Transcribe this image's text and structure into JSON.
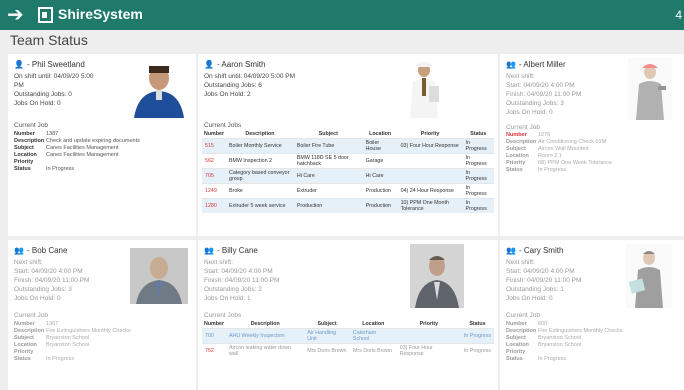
{
  "app": {
    "brand": "ShireSystem",
    "back_icon": "back-arrow-icon",
    "corner_glyph": "4"
  },
  "page": {
    "title": "Team Status"
  },
  "labels": {
    "current_job": "Current Job",
    "current_jobs": "Current Jobs",
    "number": "Number",
    "description": "Description",
    "subject": "Subject",
    "location": "Location",
    "priority": "Priority",
    "status": "Status"
  },
  "cards": [
    {
      "name": "- Phil Sweetland",
      "line1": "On shift until: 04/09/20 5:00",
      "line2": "PM",
      "line3": "Outstanding Jobs: 0",
      "line4": "Jobs On Hold: 0",
      "job": {
        "number": "1387",
        "description": "Check and update expiring documents",
        "subject": "Canes Facilities Management",
        "location": "Canes Facilities Management",
        "priority": "",
        "status": "In Progress"
      }
    },
    {
      "name": "- Aaron Smith",
      "line1": "On shift until: 04/09/20 5:00 PM",
      "line2": "Outstanding Jobs: 6",
      "line3": "Jobs On Hold: 2",
      "jobs": [
        {
          "number": "515",
          "description": "Boiler Monthly Service",
          "subject": "Boiler Fire Tube",
          "location": "Boiler House",
          "priority": "03) Four Hour Response",
          "status": "In Progress"
        },
        {
          "number": "562",
          "description": "BMW Inspection 2",
          "subject": "BMW 118D SE 5 door hatchback",
          "location": "Garage",
          "priority": "",
          "status": "In Progress"
        },
        {
          "number": "705",
          "description": "Category based conveyor group",
          "subject": "Hi Care",
          "location": "Hi Care",
          "priority": "",
          "status": "In Progress"
        },
        {
          "number": "1249",
          "description": "Broke",
          "subject": "Extruder",
          "location": "Production",
          "priority": "04) 24 Hour Response",
          "status": "In Progress"
        },
        {
          "number": "1280",
          "description": "Extruder 5 week service",
          "subject": "Production",
          "location": "Production",
          "priority": "10) PPM One Month Tolerance",
          "status": "In Progress"
        }
      ]
    },
    {
      "name": "- Albert Miller",
      "line1": "Next shift:",
      "line2": "Start: 04/09/20 4:00 PM",
      "line3": "Finish: 04/09/20 11:00 PM",
      "line4": "Outstanding Jobs: 3",
      "line5": "Jobs On Hold: 0",
      "job": {
        "number": "1276",
        "description": "Air Conditioning Check 01M",
        "subject": "Aircon Wall Mounted",
        "location": "Room 2.1",
        "priority": "08) PPM One Week Tolerance",
        "status": "In Progress"
      }
    },
    {
      "name": "- Bob Cane",
      "line1": "Next shift:",
      "line2": "Start: 04/09/20 4:00 PM",
      "line3": "Finish: 04/09/20 11:00 PM",
      "line4": "Outstanding Jobs: 3",
      "line5": "Jobs On Hold: 0",
      "job": {
        "number": "1367",
        "description": "Fire Extinguishers Monthly Checks",
        "subject": "Bryanston School",
        "location": "Bryanston School",
        "priority": "",
        "status": "In Progress"
      }
    },
    {
      "name": "- Billy Cane",
      "line1": "Next shift:",
      "line2": "Start: 04/09/20 4:00 PM",
      "line3": "Finish: 04/09/20 11:00 PM",
      "line4": "Outstanding Jobs: 2",
      "line5": "Jobs On Hold: 1",
      "jobs": [
        {
          "number": "700",
          "description": "AHU Weekly Inspection",
          "subject": "Air Handling Unit",
          "location": "Caterham School",
          "priority": "",
          "status": "In Progress"
        },
        {
          "number": "752",
          "description": "Aircon leaking water down wall",
          "subject": "Mrs Doris Brown",
          "location": "Mrs Doris Brown",
          "priority": "03) Four Hour Response",
          "status": "In Progress"
        }
      ]
    },
    {
      "name": "- Cary Smith",
      "line1": "Next shift:",
      "line2": "Start: 04/09/20 4:00 PM",
      "line3": "Finish: 04/09/20 11:00 PM",
      "line4": "Outstanding Jobs: 1",
      "line5": "Jobs On Hold: 0",
      "job": {
        "number": "800",
        "description": "Fire Extinguishers Monthly Checks",
        "subject": "Bryanston School",
        "location": "Bryanston School",
        "priority": "",
        "status": "In Progress"
      }
    }
  ],
  "colors": {
    "header": "#1f7a6c",
    "number_red": "#dd3333",
    "row_alt": "#e6f0f8"
  }
}
